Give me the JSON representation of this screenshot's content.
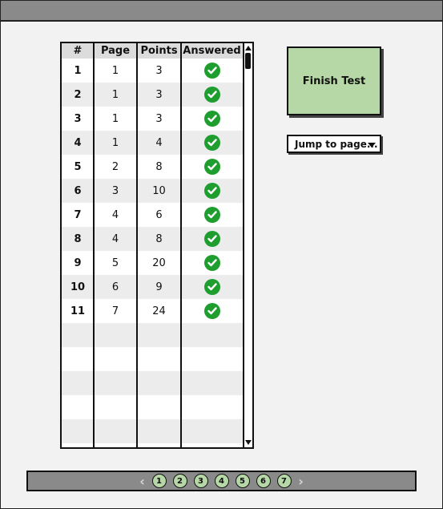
{
  "table": {
    "columns": [
      "#",
      "Page",
      "Points",
      "Answered"
    ],
    "rows": [
      {
        "num": "1",
        "page": "1",
        "points": "3",
        "answered": true
      },
      {
        "num": "2",
        "page": "1",
        "points": "3",
        "answered": true
      },
      {
        "num": "3",
        "page": "1",
        "points": "3",
        "answered": true
      },
      {
        "num": "4",
        "page": "1",
        "points": "4",
        "answered": true
      },
      {
        "num": "5",
        "page": "2",
        "points": "8",
        "answered": true
      },
      {
        "num": "6",
        "page": "3",
        "points": "10",
        "answered": true
      },
      {
        "num": "7",
        "page": "4",
        "points": "6",
        "answered": true
      },
      {
        "num": "8",
        "page": "4",
        "points": "8",
        "answered": true
      },
      {
        "num": "9",
        "page": "5",
        "points": "20",
        "answered": true
      },
      {
        "num": "10",
        "page": "6",
        "points": "9",
        "answered": true
      },
      {
        "num": "11",
        "page": "7",
        "points": "24",
        "answered": true
      }
    ],
    "answered_icon": "check-circle-icon",
    "answered_color": "#1e9e2e"
  },
  "actions": {
    "finish_label": "Finish Test",
    "finish_color": "#b6d8a6",
    "jump_label": "Jump to page..."
  },
  "pager": {
    "prev_icon": "chevron-left-icon",
    "next_icon": "chevron-right-icon",
    "pages": [
      "1",
      "2",
      "3",
      "4",
      "5",
      "6",
      "7"
    ]
  }
}
